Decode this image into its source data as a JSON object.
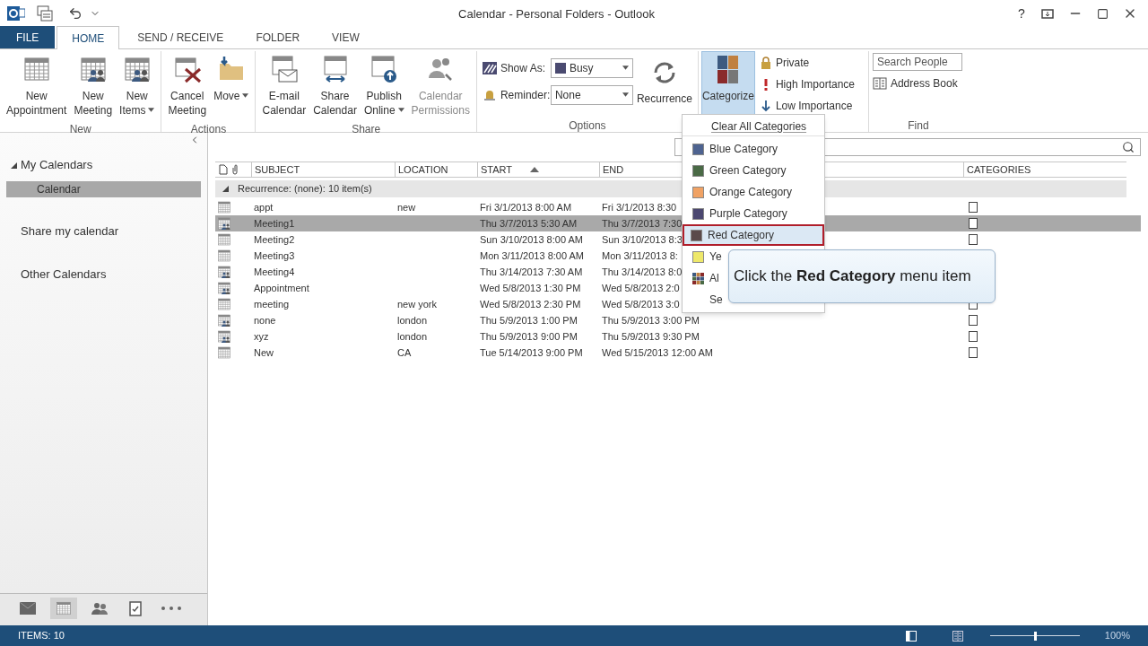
{
  "window": {
    "title": "Calendar - Personal Folders - Outlook",
    "help": "?"
  },
  "tabs": [
    {
      "label": "FILE",
      "kind": "file",
      "selected": false
    },
    {
      "label": "HOME",
      "kind": "tab",
      "selected": true
    },
    {
      "label": "SEND / RECEIVE",
      "kind": "tab",
      "selected": false
    },
    {
      "label": "FOLDER",
      "kind": "tab",
      "selected": false
    },
    {
      "label": "VIEW",
      "kind": "tab",
      "selected": false
    }
  ],
  "ribbon": {
    "groups": [
      {
        "label": "New",
        "buttons": [
          {
            "label": "New\nAppointment",
            "dropdown": false,
            "disabled": false
          },
          {
            "label": "New\nMeeting",
            "dropdown": false,
            "disabled": false
          },
          {
            "label": "New\nItems",
            "dropdown": true,
            "disabled": false
          }
        ]
      },
      {
        "label": "Actions",
        "buttons": [
          {
            "label": "Cancel\nMeeting",
            "dropdown": false,
            "disabled": false
          },
          {
            "label": "Move",
            "dropdown": true,
            "disabled": false
          }
        ]
      },
      {
        "label": "Share",
        "buttons": [
          {
            "label": "E-mail\nCalendar",
            "dropdown": false,
            "disabled": false
          },
          {
            "label": "Share\nCalendar",
            "dropdown": false,
            "disabled": false
          },
          {
            "label": "Publish\nOnline",
            "dropdown": true,
            "disabled": false
          },
          {
            "label": "Calendar\nPermissions",
            "dropdown": false,
            "disabled": true
          }
        ]
      }
    ],
    "options": {
      "label": "Options",
      "show_as": {
        "label": "Show As:",
        "value": "Busy"
      },
      "reminder": {
        "label": "Reminder:",
        "value": "None"
      },
      "recurrence": "Recurrence"
    },
    "tags": {
      "categorize": {
        "label": "Categorize",
        "selected": true
      },
      "items": [
        "Private",
        "High Importance",
        "Low Importance"
      ]
    },
    "find": {
      "label": "Find",
      "search": {
        "placeholder": "Search People"
      },
      "address_book": "Address Book"
    }
  },
  "sidebar": {
    "sections": [
      {
        "label": "My Calendars",
        "expanded": true,
        "children": [
          {
            "label": "Calendar",
            "selected": true
          }
        ]
      },
      {
        "label": "Share my calendar"
      },
      {
        "label": "Other Calendars"
      }
    ],
    "nav": [
      {
        "selected": false
      },
      {
        "selected": true
      },
      {
        "selected": false
      },
      {
        "selected": false
      },
      {
        "selected": false
      }
    ]
  },
  "table": {
    "columns": [
      "SUBJECT",
      "LOCATION",
      "START",
      "END",
      "CATEGORIES"
    ],
    "group": "Recurrence: (none): 10 item(s)",
    "rows": [
      {
        "kind": "appointment",
        "subject": "appt",
        "location": "new",
        "start": "Fri 3/1/2013 8:00 AM",
        "end": "Fri 3/1/2013 8:30",
        "selected": false
      },
      {
        "kind": "meeting",
        "subject": "Meeting1",
        "location": "",
        "start": "Thu 3/7/2013 5:30 AM",
        "end": "Thu 3/7/2013 7:30",
        "selected": true
      },
      {
        "kind": "appointment",
        "subject": "Meeting2",
        "location": "",
        "start": "Sun 3/10/2013 8:00 AM",
        "end": "Sun 3/10/2013 8:3",
        "selected": false
      },
      {
        "kind": "appointment",
        "subject": "Meeting3",
        "location": "",
        "start": "Mon 3/11/2013 8:00 AM",
        "end": "Mon 3/11/2013 8:",
        "selected": false
      },
      {
        "kind": "meeting",
        "subject": "Meeting4",
        "location": "",
        "start": "Thu 3/14/2013 7:30 AM",
        "end": "Thu 3/14/2013 8:0",
        "selected": false
      },
      {
        "kind": "meeting",
        "subject": "Appointment",
        "location": "",
        "start": "Wed 5/8/2013 1:30 PM",
        "end": "Wed 5/8/2013 2:0",
        "selected": false
      },
      {
        "kind": "appointment",
        "subject": "meeting",
        "location": "new york",
        "start": "Wed 5/8/2013 2:30 PM",
        "end": "Wed 5/8/2013 3:0",
        "selected": false
      },
      {
        "kind": "meeting",
        "subject": "none",
        "location": "london",
        "start": "Thu 5/9/2013 1:00 PM",
        "end": "Thu 5/9/2013 3:00 PM",
        "selected": false
      },
      {
        "kind": "meeting",
        "subject": "xyz",
        "location": "london",
        "start": "Thu 5/9/2013 9:00 PM",
        "end": "Thu 5/9/2013 9:30 PM",
        "selected": false
      },
      {
        "kind": "appointment",
        "subject": "New",
        "location": "CA",
        "start": "Tue 5/14/2013 9:00 PM",
        "end": "Wed 5/15/2013 12:00 AM",
        "selected": false
      }
    ]
  },
  "menu": {
    "header": "Clear All Categories",
    "items": [
      {
        "kind": "color",
        "label": "Blue Category",
        "color": "#4e6390",
        "selected": false
      },
      {
        "kind": "color",
        "label": "Green Category",
        "color": "#4a6a46",
        "selected": false
      },
      {
        "kind": "color",
        "label": "Orange Category",
        "color": "#f0a264",
        "selected": false
      },
      {
        "kind": "color",
        "label": "Purple Category",
        "color": "#4b4770",
        "selected": false
      },
      {
        "kind": "color",
        "label": "Red Category",
        "color": "#5b4a4a",
        "selected": true
      },
      {
        "kind": "color",
        "label": "Ye",
        "color": "#eee86a",
        "selected": false
      },
      {
        "kind": "all",
        "label": "Al"
      },
      {
        "kind": "plain",
        "label": "Se"
      }
    ]
  },
  "tooltip": "Click the **Red Category** menu item",
  "status_bar": {
    "items": "ITEMS: 10",
    "zoom": {
      "level": 0.5,
      "reading": "100%"
    }
  }
}
